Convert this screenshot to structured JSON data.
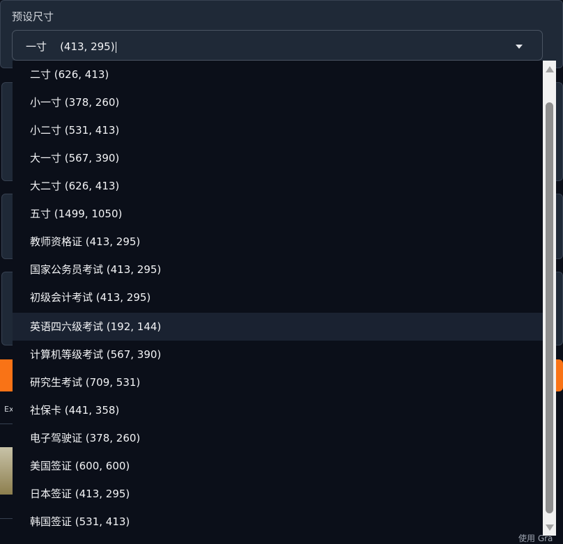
{
  "preset": {
    "label": "预设尺寸",
    "selected": "一寸    (413, 295)"
  },
  "options": [
    {
      "label": "二寸 (626, 413)"
    },
    {
      "label": "小一寸 (378, 260)"
    },
    {
      "label": "小二寸 (531, 413)"
    },
    {
      "label": "大一寸 (567, 390)"
    },
    {
      "label": "大二寸 (626, 413)"
    },
    {
      "label": "五寸 (1499, 1050)"
    },
    {
      "label": "教师资格证 (413, 295)"
    },
    {
      "label": "国家公务员考试 (413, 295)"
    },
    {
      "label": "初级会计考试 (413, 295)"
    },
    {
      "label": "英语四六级考试 (192, 144)"
    },
    {
      "label": "计算机等级考试 (567, 390)"
    },
    {
      "label": "研究生考试 (709, 531)"
    },
    {
      "label": "社保卡 (441, 358)"
    },
    {
      "label": "电子驾驶证 (378, 260)"
    },
    {
      "label": "美国签证 (600, 600)"
    },
    {
      "label": "日本签证 (413, 295)"
    },
    {
      "label": "韩国签证 (531, 413)"
    }
  ],
  "background": {
    "partial_text_left": "Ex",
    "footer_partial": "使用 Gra"
  },
  "colors": {
    "page_bg": "#0b0f19",
    "panel_bg": "#1f2937",
    "accent_orange": "#f97316",
    "highlight_row": "#1a2231"
  }
}
